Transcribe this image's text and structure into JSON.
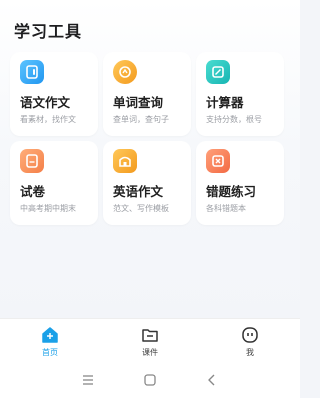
{
  "page": {
    "title": "学习工具"
  },
  "tools": [
    {
      "name": "语文作文",
      "desc": "看素材，找作文",
      "icon": "essay-book-icon",
      "color": "#2ea8f2"
    },
    {
      "name": "单词查询",
      "desc": "查单词，查句子",
      "icon": "word-lookup-icon",
      "color": "#f5a531"
    },
    {
      "name": "计算器",
      "desc": "支持分数，根号",
      "icon": "calculator-icon",
      "color": "#22c3bd"
    },
    {
      "name": "试卷",
      "desc": "中高考期中期末",
      "icon": "exam-paper-icon",
      "color": "#f6945d"
    },
    {
      "name": "英语作文",
      "desc": "范文、写作模板",
      "icon": "english-essay-icon",
      "color": "#f5a531"
    },
    {
      "name": "错题练习",
      "desc": "各科错题本",
      "icon": "wrong-questions-icon",
      "color": "#f6845d"
    }
  ],
  "tabbar": {
    "items": [
      {
        "label": "首页",
        "icon": "home-icon",
        "active": true
      },
      {
        "label": "课件",
        "icon": "courseware-icon",
        "active": false
      },
      {
        "label": "我",
        "icon": "profile-icon",
        "active": false
      }
    ],
    "accent": "#1aa0e8"
  },
  "system_nav": {
    "buttons": [
      "menu-icon",
      "home-square-icon",
      "back-icon"
    ]
  }
}
